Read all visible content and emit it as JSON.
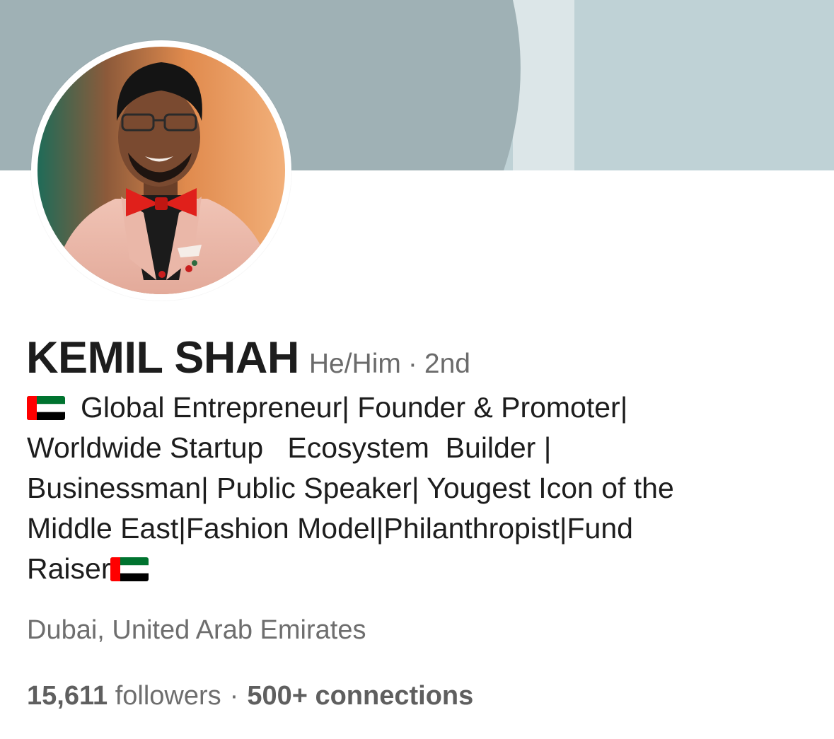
{
  "profile": {
    "name": "KEMIL SHAH",
    "pronouns": "He/Him",
    "degree_separator": "·",
    "degree": "2nd",
    "headline": {
      "line1": "Global Entrepreneur| Founder & Promoter|",
      "line2": "Worldwide Startup   Ecosystem  Builder |",
      "line3": "Businessman| Public Speaker| Yougest Icon of the",
      "line4": "Middle East|Fashion Model|Philanthropist|Fund",
      "line5": "Raiser"
    },
    "location": "Dubai, United Arab Emirates",
    "followers_count": "15,611",
    "followers_label": "followers",
    "stats_separator": "·",
    "connections": "500+ connections"
  },
  "colors": {
    "banner_light": "#bfd2d6",
    "banner_dark": "#9fb1b5",
    "banner_divider": "#dce6e8",
    "name_text": "#1d1d1d",
    "secondary_text": "#6e6e6e"
  },
  "icons": {
    "flag": "uae-flag-icon",
    "avatar": "profile-photo"
  }
}
